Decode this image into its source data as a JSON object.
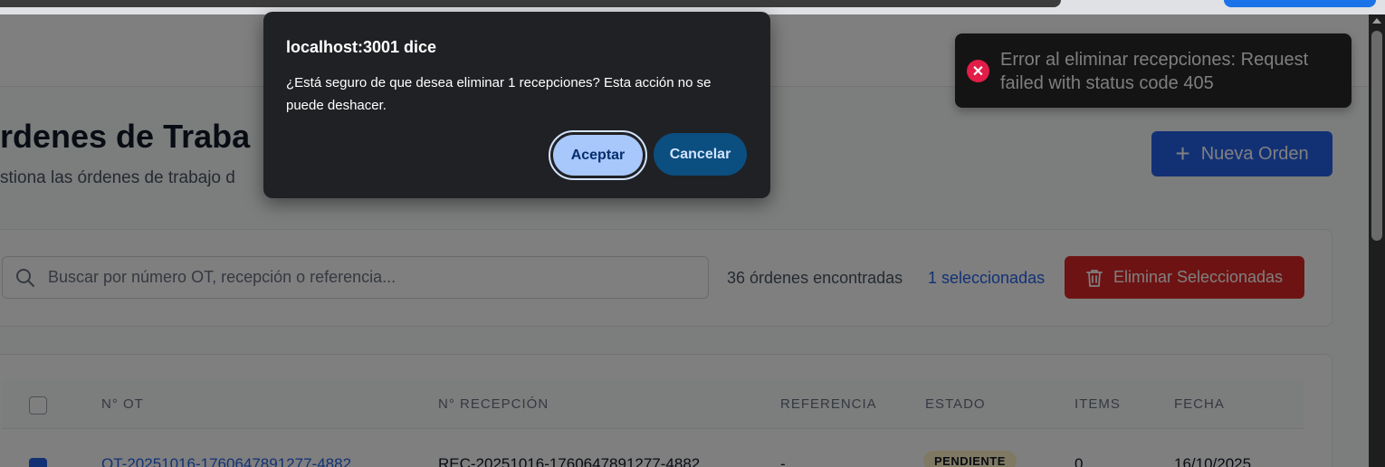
{
  "dialog": {
    "title": "localhost:3001 dice",
    "message": "¿Está seguro de que desea eliminar 1 recepciones? Esta acción no se puede deshacer.",
    "accept_label": "Aceptar",
    "cancel_label": "Cancelar"
  },
  "toast": {
    "icon": "error-x-icon",
    "message": "Error al eliminar recepciones: Request failed with status code 405",
    "color": "#e11d48"
  },
  "page": {
    "title": "rdenes de Traba",
    "subtitle": "stiona las órdenes de trabajo d",
    "new_order_label": "Nueva Orden"
  },
  "filters": {
    "search_placeholder": "Buscar por número OT, recepción o referencia...",
    "count_text": "36 órdenes encontradas",
    "selected_text": "1 seleccionadas",
    "delete_label": "Eliminar Seleccionadas"
  },
  "table": {
    "columns": [
      "N° OT",
      "N° RECEPCIÓN",
      "REFERENCIA",
      "ESTADO",
      "ITEMS",
      "FECHA"
    ],
    "rows": [
      {
        "selected": true,
        "ot": "OT-20251016-1760647891277-4882",
        "recepcion": "REC-20251016-1760647891277-4882",
        "referencia": "-",
        "estado": "PENDIENTE",
        "items": "0",
        "fecha": "16/10/2025"
      }
    ]
  },
  "colors": {
    "primary": "#2563eb",
    "danger": "#dc2626",
    "dialog_bg": "#202124",
    "accept_bg": "#a8c7fa",
    "cancel_bg": "#0b4e80"
  }
}
